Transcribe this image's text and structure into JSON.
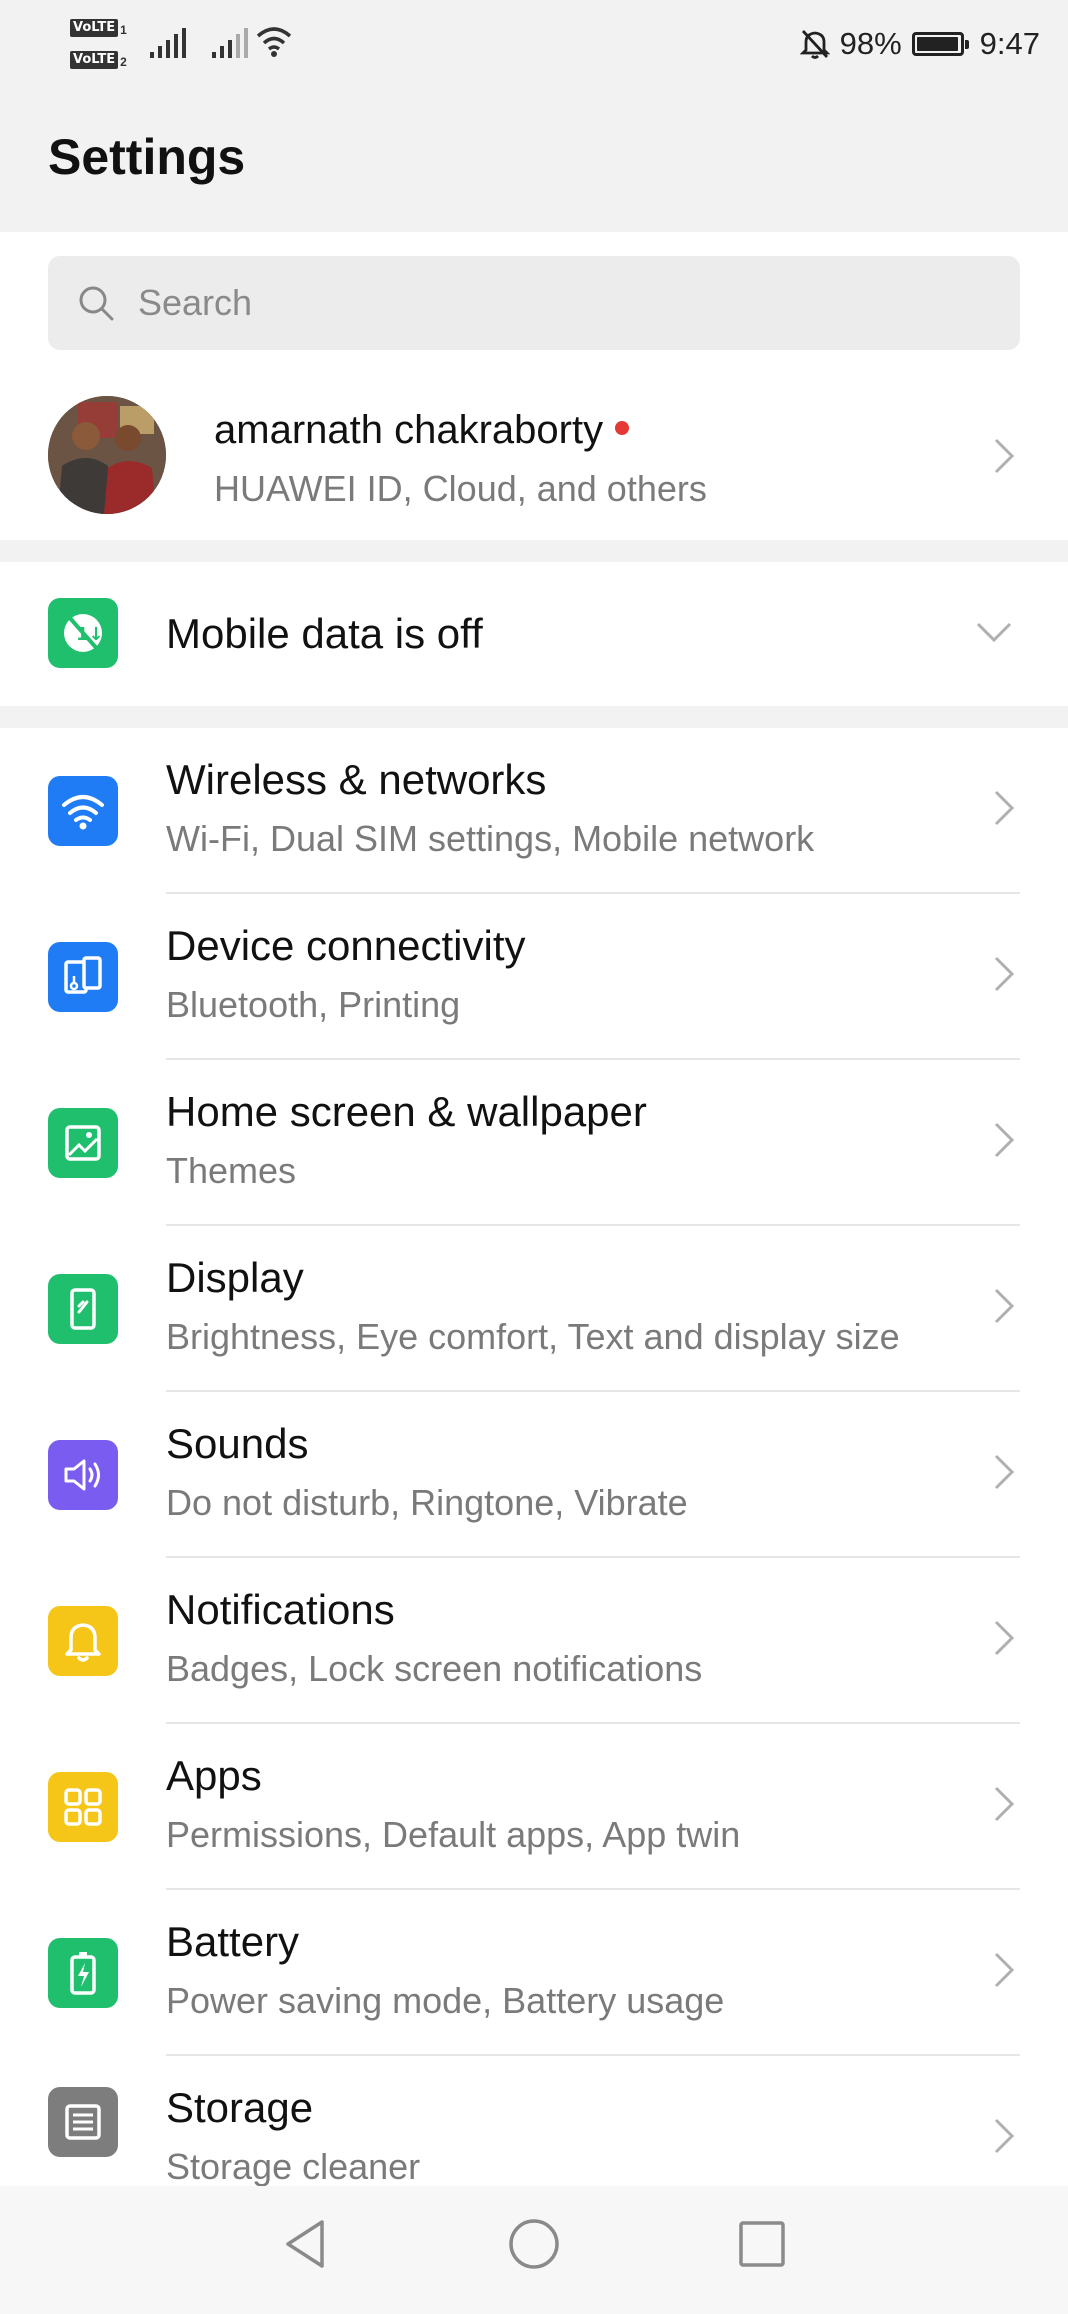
{
  "status_bar": {
    "sim1_tag": "VoLTE",
    "sim1_num": "1",
    "sim2_tag": "VoLTE",
    "sim2_num": "2",
    "battery_percent": "98%",
    "battery_level": 0.98,
    "time": "9:47",
    "icons": [
      "signal-icon",
      "signal-icon",
      "wifi-icon",
      "mute-bell-icon",
      "battery-icon"
    ]
  },
  "header": {
    "title": "Settings"
  },
  "search": {
    "placeholder": "Search",
    "value": ""
  },
  "account": {
    "name": "amarnath chakraborty",
    "subtitle": "HUAWEI ID, Cloud, and others",
    "has_notification_dot": true
  },
  "mobile_data": {
    "label": "Mobile data is off"
  },
  "items": [
    {
      "title": "Wireless & networks",
      "subtitle": "Wi-Fi, Dual SIM settings, Mobile network",
      "icon": "wifi-icon",
      "color": "#1f7cf5"
    },
    {
      "title": "Device connectivity",
      "subtitle": "Bluetooth, Printing",
      "icon": "device-connectivity-icon",
      "color": "#1f7cf5"
    },
    {
      "title": "Home screen & wallpaper",
      "subtitle": "Themes",
      "icon": "wallpaper-icon",
      "color": "#1fbf6e"
    },
    {
      "title": "Display",
      "subtitle": "Brightness, Eye comfort, Text and display size",
      "icon": "display-icon",
      "color": "#1fbf6e"
    },
    {
      "title": "Sounds",
      "subtitle": "Do not disturb, Ringtone, Vibrate",
      "icon": "speaker-icon",
      "color": "#7b5cf0"
    },
    {
      "title": "Notifications",
      "subtitle": "Badges, Lock screen notifications",
      "icon": "bell-icon",
      "color": "#f5c518"
    },
    {
      "title": "Apps",
      "subtitle": "Permissions, Default apps, App twin",
      "icon": "apps-grid-icon",
      "color": "#f5c518"
    },
    {
      "title": "Battery",
      "subtitle": "Power saving mode, Battery usage",
      "icon": "battery-charge-icon",
      "color": "#1fbf6e"
    },
    {
      "title": "Storage",
      "subtitle": "Storage cleaner",
      "icon": "storage-icon",
      "color": "#7d7d7d"
    }
  ],
  "nav": {
    "buttons": [
      "back-icon",
      "home-icon",
      "recents-icon"
    ]
  }
}
